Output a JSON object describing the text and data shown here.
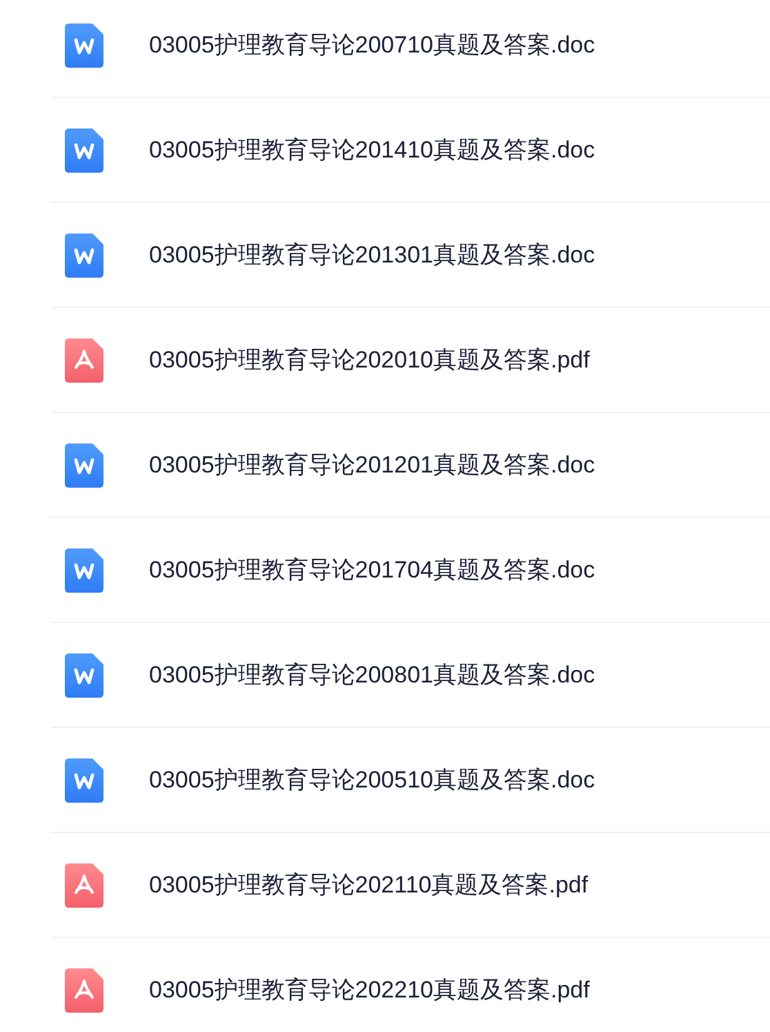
{
  "files": [
    {
      "kind": "doc",
      "name": "03005护理教育导论200710真题及答案.doc"
    },
    {
      "kind": "doc",
      "name": "03005护理教育导论201410真题及答案.doc"
    },
    {
      "kind": "doc",
      "name": "03005护理教育导论201301真题及答案.doc"
    },
    {
      "kind": "pdf",
      "name": "03005护理教育导论202010真题及答案.pdf"
    },
    {
      "kind": "doc",
      "name": "03005护理教育导论201201真题及答案.doc"
    },
    {
      "kind": "doc",
      "name": "03005护理教育导论201704真题及答案.doc"
    },
    {
      "kind": "doc",
      "name": "03005护理教育导论200801真题及答案.doc"
    },
    {
      "kind": "doc",
      "name": "03005护理教育导论200510真题及答案.doc"
    },
    {
      "kind": "pdf",
      "name": "03005护理教育导论202110真题及答案.pdf"
    },
    {
      "kind": "pdf",
      "name": "03005护理教育导论202210真题及答案.pdf"
    }
  ]
}
